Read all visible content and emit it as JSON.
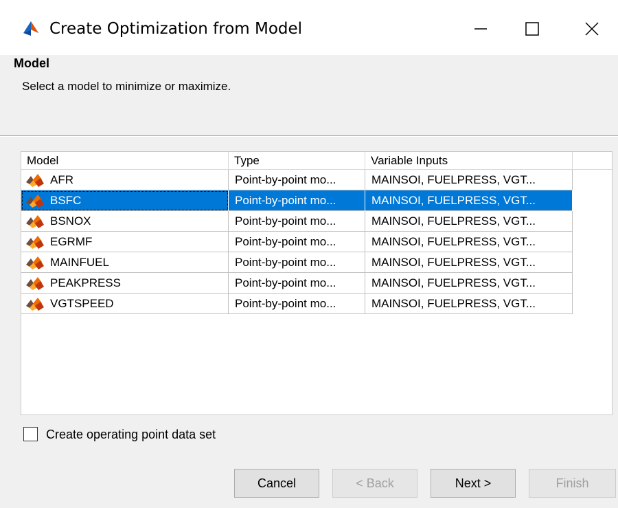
{
  "window": {
    "title": "Create Optimization from Model",
    "controls": {
      "minimize": "—",
      "maximize": "□",
      "close": "✕"
    }
  },
  "header": {
    "heading": "Model",
    "description": "Select a model to minimize or maximize."
  },
  "table": {
    "columns": [
      "Model",
      "Type",
      "Variable Inputs"
    ],
    "rows": [
      {
        "model": "AFR",
        "type": "Point-by-point mo...",
        "inputs": "MAINSOI, FUELPRESS, VGT...",
        "selected": false
      },
      {
        "model": "BSFC",
        "type": "Point-by-point mo...",
        "inputs": "MAINSOI, FUELPRESS, VGT...",
        "selected": true
      },
      {
        "model": "BSNOX",
        "type": "Point-by-point mo...",
        "inputs": "MAINSOI, FUELPRESS, VGT...",
        "selected": false
      },
      {
        "model": "EGRMF",
        "type": "Point-by-point mo...",
        "inputs": "MAINSOI, FUELPRESS, VGT...",
        "selected": false
      },
      {
        "model": "MAINFUEL",
        "type": "Point-by-point mo...",
        "inputs": "MAINSOI, FUELPRESS, VGT...",
        "selected": false
      },
      {
        "model": "PEAKPRESS",
        "type": "Point-by-point mo...",
        "inputs": "MAINSOI, FUELPRESS, VGT...",
        "selected": false
      },
      {
        "model": "VGTSPEED",
        "type": "Point-by-point mo...",
        "inputs": "MAINSOI, FUELPRESS, VGT...",
        "selected": false
      }
    ],
    "row_icon": "model-icon",
    "selection_color": "#0078d7"
  },
  "options": {
    "create_operating_point_label": "Create operating point data set",
    "create_operating_point_checked": false
  },
  "buttons": {
    "cancel": "Cancel",
    "back": "< Back",
    "next": "Next >",
    "finish": "Finish"
  }
}
